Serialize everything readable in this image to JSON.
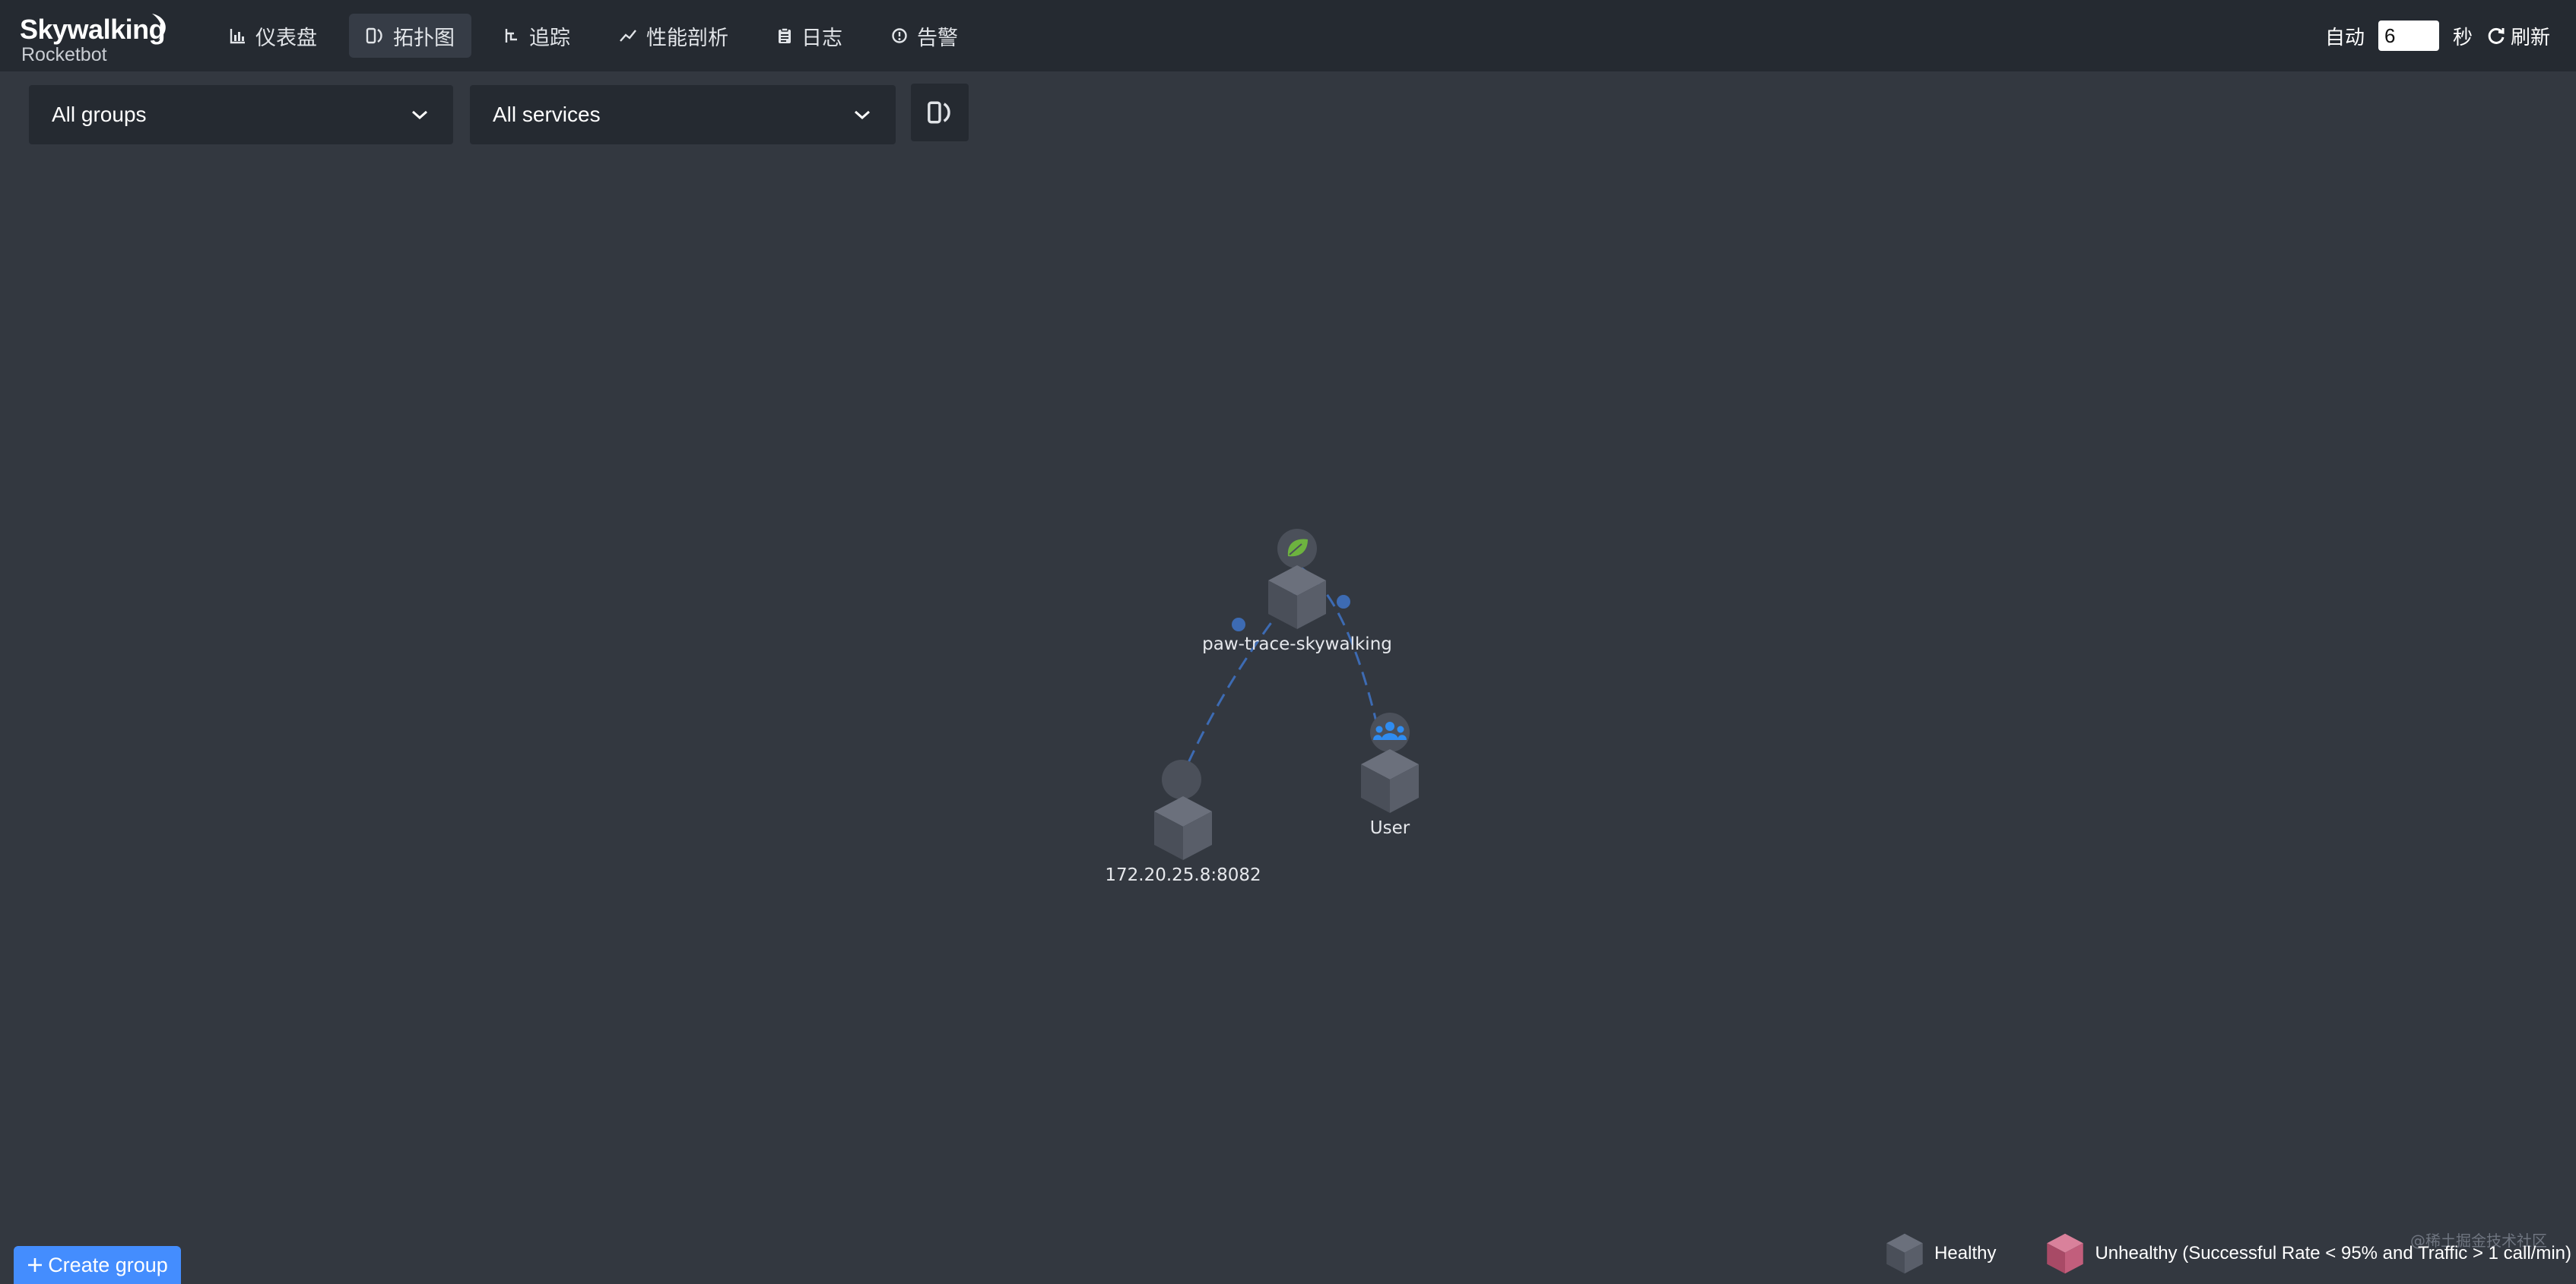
{
  "app": {
    "brand": "Skywalking",
    "subtitle": "Rocketbot"
  },
  "nav": {
    "items": [
      {
        "label": "仪表盘",
        "icon": "chart-icon"
      },
      {
        "label": "拓扑图",
        "icon": "topology-icon",
        "active": true
      },
      {
        "label": "追踪",
        "icon": "trace-icon"
      },
      {
        "label": "性能剖析",
        "icon": "profile-icon"
      },
      {
        "label": "日志",
        "icon": "log-icon"
      },
      {
        "label": "告警",
        "icon": "alarm-icon"
      }
    ]
  },
  "header": {
    "auto_label": "自动",
    "interval_value": "6",
    "interval_unit": "秒",
    "refresh_label": "刷新"
  },
  "toolbar": {
    "groups_selected": "All groups",
    "services_selected": "All services"
  },
  "topology": {
    "nodes": [
      {
        "id": "paw",
        "label": "paw-trace-skywalking",
        "type": "spring-boot",
        "status": "healthy"
      },
      {
        "id": "ip",
        "label": "172.20.25.8:8082",
        "type": "unknown",
        "status": "healthy"
      },
      {
        "id": "user",
        "label": "User",
        "type": "user",
        "status": "healthy"
      }
    ],
    "links": [
      {
        "source": "paw",
        "target": "ip"
      },
      {
        "source": "user",
        "target": "paw"
      }
    ]
  },
  "legend": {
    "healthy": "Healthy",
    "unhealthy": "Unhealthy (Successful Rate < 95% and Traffic > 1 call/min)"
  },
  "watermark": "@稀土掘金技术社区",
  "create_group": "Create group",
  "colors": {
    "background": "#333840",
    "header": "#252a31",
    "link": "#3d6bb3",
    "healthy_cube": "#5a5f6b",
    "unhealthy_cube": "#c9627f",
    "accent": "#448dfe",
    "spring": "#6db33f"
  }
}
